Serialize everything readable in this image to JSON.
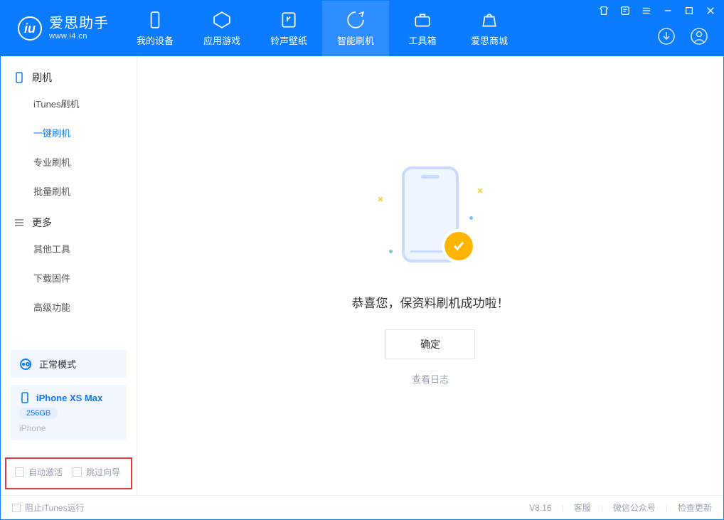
{
  "app": {
    "title": "爱思助手",
    "subtitle": "www.i4.cn"
  },
  "nav": {
    "device": "我的设备",
    "apps": "应用游戏",
    "ring": "铃声壁纸",
    "flash": "智能刷机",
    "tools": "工具箱",
    "store": "爱思商城"
  },
  "sidebar": {
    "section_flash": "刷机",
    "items_flash": {
      "itunes": "iTunes刷机",
      "oneclick": "一键刷机",
      "pro": "专业刷机",
      "batch": "批量刷机"
    },
    "section_more": "更多",
    "items_more": {
      "other": "其他工具",
      "firmware": "下载固件",
      "advanced": "高级功能"
    },
    "mode": "正常模式",
    "device_name": "iPhone XS Max",
    "device_capacity": "256GB",
    "device_type": "iPhone",
    "opt_auto_activate": "自动激活",
    "opt_skip_guide": "跳过向导"
  },
  "main": {
    "success_msg": "恭喜您，保资料刷机成功啦！",
    "ok": "确定",
    "view_log": "查看日志"
  },
  "status": {
    "block_itunes": "阻止iTunes运行",
    "version": "V8.16",
    "support": "客服",
    "wechat": "微信公众号",
    "update": "检查更新"
  }
}
